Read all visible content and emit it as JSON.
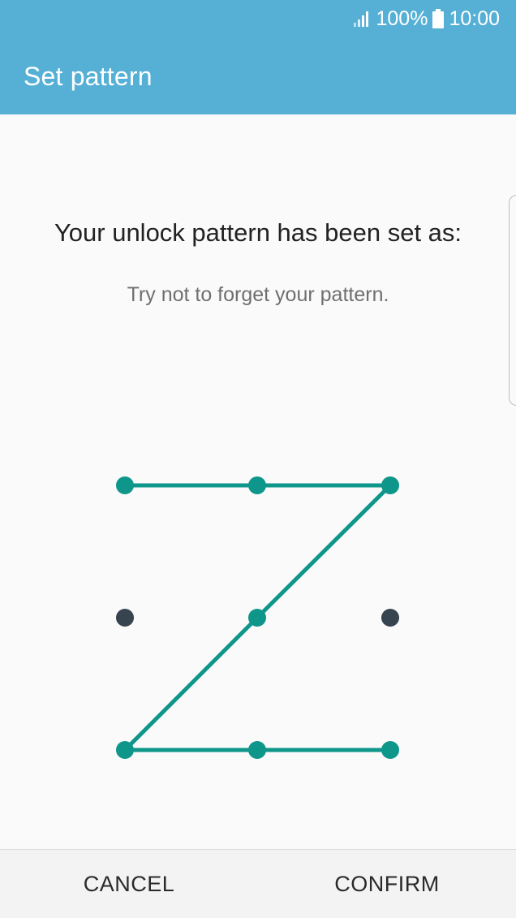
{
  "status_bar": {
    "battery_percent": "100%",
    "time": "10:00",
    "signal_icon": "signal-icon",
    "battery_icon": "battery-icon"
  },
  "app_bar": {
    "title": "Set pattern"
  },
  "main": {
    "heading": "Your unlock pattern has been set as:",
    "subtext": "Try not to forget your pattern."
  },
  "pattern": {
    "grid_size": 3,
    "active_color": "#0f968a",
    "inactive_color": "#37434f",
    "sequence": [
      1,
      2,
      3,
      5,
      7,
      8,
      9
    ]
  },
  "buttons": {
    "cancel_label": "CANCEL",
    "confirm_label": "CONFIRM"
  },
  "colors": {
    "accent": "#56b0d6"
  }
}
